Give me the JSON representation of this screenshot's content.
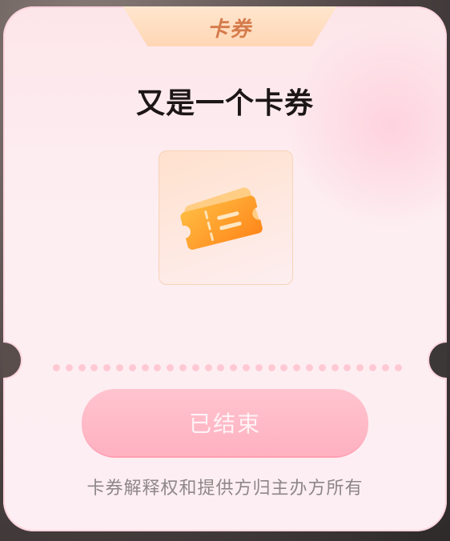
{
  "coupon_card": {
    "tag": "卡券",
    "title": "又是一个卡券",
    "button_label": "已结束",
    "footer_note": "卡券解释权和提供方归主办方所有",
    "icon": "ticket-icon",
    "colors": {
      "tag_text": "#d57a4b",
      "button_bg": "#ffb1c0",
      "ticket_orange": "#ff9a1a"
    }
  }
}
